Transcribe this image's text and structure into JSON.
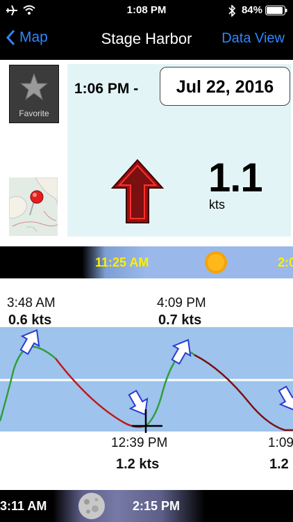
{
  "status_bar": {
    "time": "1:08 PM",
    "battery": "84%",
    "icons": [
      "airplane-icon",
      "wifi-icon",
      "bluetooth-icon",
      "battery-icon"
    ]
  },
  "nav": {
    "back_label": "Map",
    "title": "Stage Harbor",
    "right_label": "Data View"
  },
  "current": {
    "time": "1:06 PM -",
    "date": "Jul 22, 2016",
    "speed": "1.1",
    "unit": "kts",
    "favorite_label": "Favorite",
    "arrow_color": "#b01010"
  },
  "sun_strip": {
    "time": "11:25 AM",
    "next_time": "2:0",
    "label_color": "#ffee00"
  },
  "tide": {
    "peaks": [
      {
        "time": "3:48 AM",
        "speed": "0.6 kts"
      },
      {
        "time": "4:09 PM",
        "speed": "0.7 kts"
      }
    ],
    "troughs": [
      {
        "time": "12:39 PM",
        "speed": "1.2 kts"
      },
      {
        "time": "1:09",
        "speed": "1.2"
      }
    ],
    "colors": {
      "flood": "#2e9e3c",
      "ebb": "#c01818",
      "band": "#9ec3ec"
    }
  },
  "moon_strip": {
    "time_left": "3:11 AM",
    "time_right": "2:15 PM"
  }
}
